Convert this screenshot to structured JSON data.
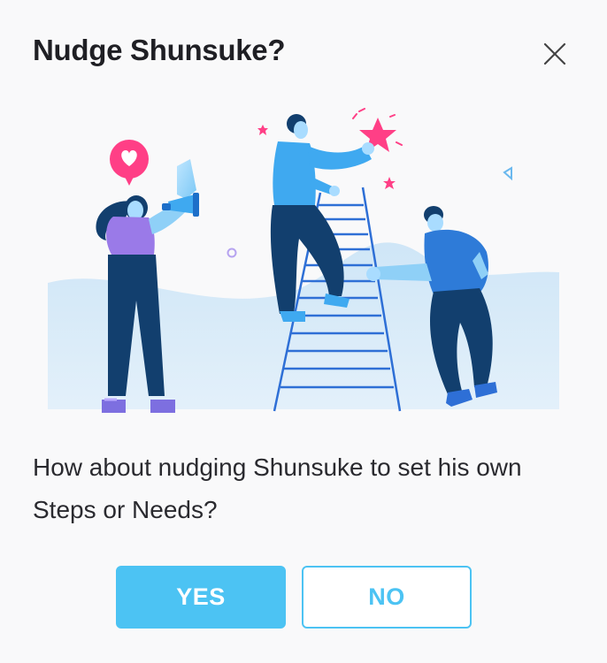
{
  "dialog": {
    "title": "Nudge Shunsuke?",
    "message": "How about nudging Shunsuke to set his own Steps or Needs?",
    "yes_label": "YES",
    "no_label": "NO"
  },
  "colors": {
    "accent": "#4cc3f3",
    "title_text": "#1f1f24",
    "body_text": "#2a2a2f",
    "background": "#f9f9fa",
    "pink": "#ff3f86",
    "navy": "#123f6e",
    "blue": "#2e7bd8"
  },
  "icons": {
    "close": "close-icon",
    "heart": "heart-icon",
    "star": "star-icon",
    "megaphone": "megaphone-icon"
  }
}
